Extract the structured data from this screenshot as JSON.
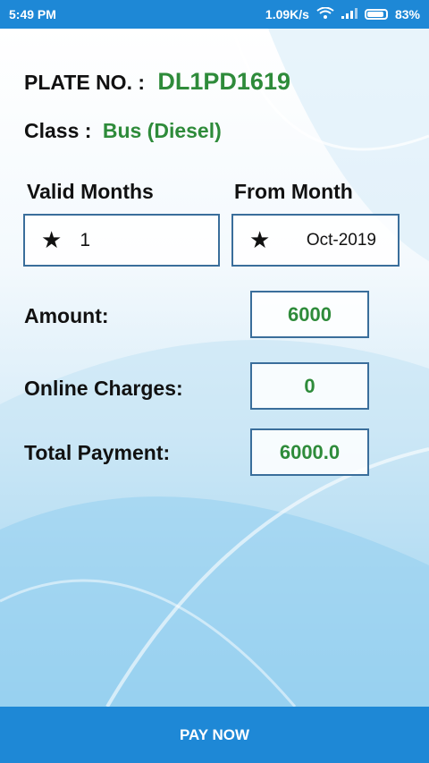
{
  "status_bar": {
    "time": "5:49 PM",
    "network_speed": "1.09K/s",
    "battery": "83%"
  },
  "vehicle": {
    "plate_label": "PLATE NO. :",
    "plate_value": "DL1PD1619",
    "class_label": "Class :",
    "class_value": "Bus (Diesel)"
  },
  "fields": {
    "valid_months_label": "Valid Months",
    "valid_months_value": "1",
    "from_month_label": "From Month",
    "from_month_value": "Oct-2019"
  },
  "payment": {
    "amount_label": "Amount:",
    "amount_value": "6000",
    "online_charges_label": "Online Charges:",
    "online_charges_value": "0",
    "total_label": "Total Payment:",
    "total_value": "6000.0"
  },
  "actions": {
    "pay_now": "PAY NOW"
  },
  "colors": {
    "accent": "#1e88d6",
    "value_green": "#2e8b3a",
    "box_border": "#3a6e9b"
  }
}
